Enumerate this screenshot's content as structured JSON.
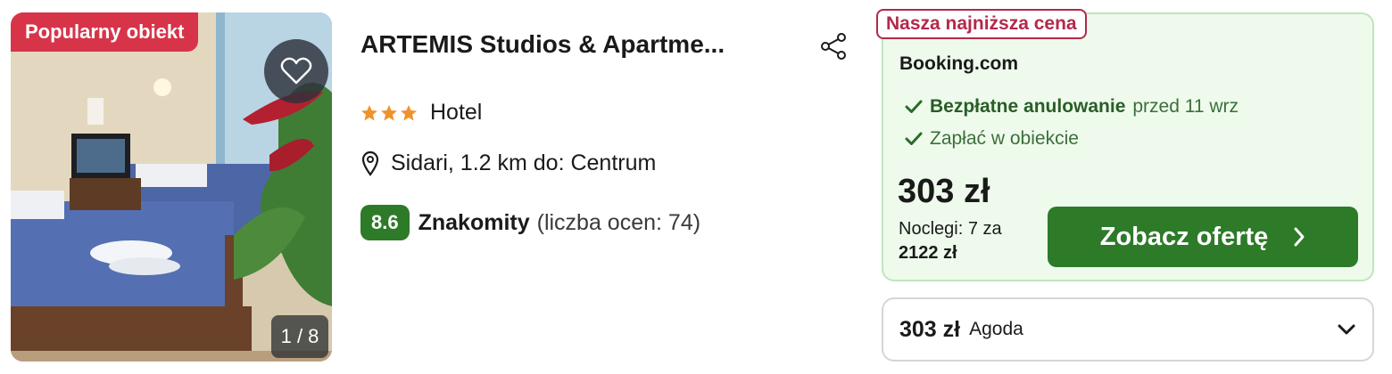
{
  "listing": {
    "badge": "Popularny obiekt",
    "photo_counter": "1 / 8",
    "title": "ARTEMIS Studios & Apartme...",
    "stars": 3,
    "type": "Hotel",
    "location": "Sidari, 1.2 km do: Centrum",
    "rating_score": "8.6",
    "rating_word": "Znakomity",
    "rating_count": "(liczba ocen: 74)"
  },
  "deal": {
    "tag": "Nasza najniższa cena",
    "provider": "Booking.com",
    "perk1_bold": "Bezpłatne anulowanie",
    "perk1_rest": "przed 11 wrz",
    "perk2": "Zapłać w obiekcie",
    "price": "303 zł",
    "nights": "Noclegi: 7 za",
    "total": "2122 zł",
    "cta": "Zobacz ofertę"
  },
  "alt_offer": {
    "price": "303 zł",
    "provider": "Agoda"
  },
  "colors": {
    "popular_badge": "#d7344a",
    "lowest_tag": "#b4284a",
    "green": "#2d7a29",
    "star": "#f0922b",
    "deal_bg": "#eefbec"
  },
  "icons": {
    "favorite": "heart-icon",
    "share": "share-icon",
    "location": "map-pin-icon",
    "perk": "check-icon",
    "cta": "chevron-right-icon",
    "alt": "chevron-down-icon"
  }
}
